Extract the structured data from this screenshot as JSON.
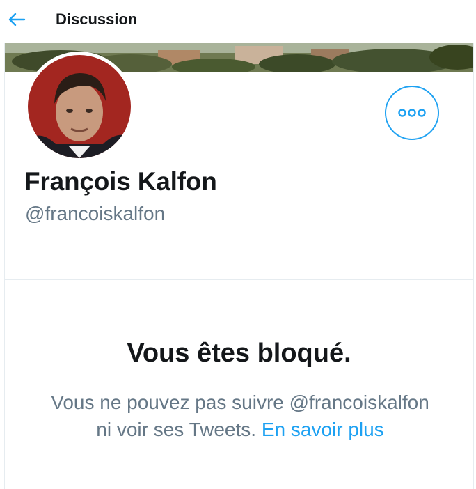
{
  "header": {
    "title": "Discussion",
    "back_icon": "arrow-left-icon",
    "accent_color": "#1da1f2"
  },
  "profile": {
    "name": "François Kalfon",
    "handle": "@francoiskalfon",
    "more_icon": "more-dots-icon"
  },
  "blocked": {
    "title": "Vous êtes bloqué.",
    "message": "Vous ne pouvez pas suivre @francoiskalfon ni voir ses Tweets.",
    "link_label": "En savoir plus"
  },
  "colors": {
    "text_primary": "#14171a",
    "text_secondary": "#657786",
    "accent": "#1da1f2",
    "border": "#e6ecf0"
  }
}
